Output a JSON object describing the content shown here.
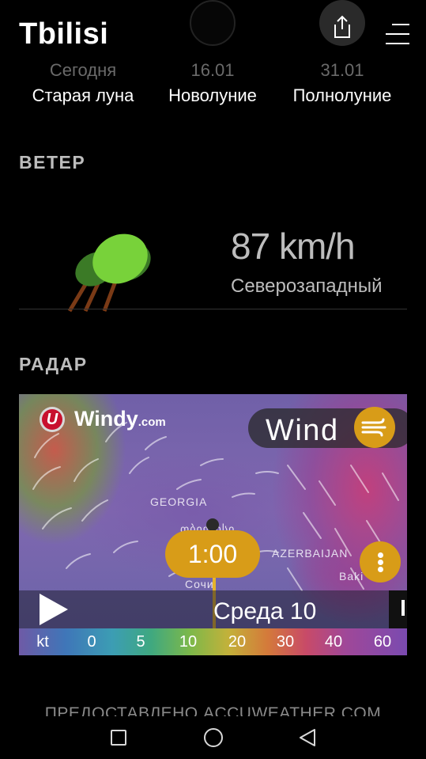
{
  "header": {
    "city": "Tbilisi",
    "share_icon": "share-icon",
    "menu_icon": "menu-icon"
  },
  "moon": {
    "items": [
      {
        "date": "Сегодня",
        "phase": "Старая луна"
      },
      {
        "date": "16.01",
        "phase": "Новолуние"
      },
      {
        "date": "31.01",
        "phase": "Полнолуние"
      }
    ]
  },
  "wind": {
    "title": "ВЕТЕР",
    "speed": "87 km/h",
    "direction": "Северозападный",
    "tree_colors": {
      "front": "#78d23a",
      "back": "#3b7a26",
      "trunk": "#7a3a16"
    }
  },
  "radar": {
    "title": "РАДАР",
    "brand": "Windy",
    "brand_suffix": ".com",
    "layer": "Wind",
    "labels": {
      "georgia": "GEORGIA",
      "azerbaijan": "AZERBAIJAN",
      "city_top": "თბილისი",
      "city_bottom": "Сочи",
      "baku": "Baki"
    },
    "time": "1:00",
    "day": "Среда 10",
    "scale_unit": "kt",
    "scale": [
      "0",
      "5",
      "10",
      "20",
      "30",
      "40",
      "60"
    ],
    "accent": "#d89c18"
  },
  "footer": {
    "provider": "ПРЕДОСТАВЛЕНО ACCUWEATHER.COM"
  }
}
